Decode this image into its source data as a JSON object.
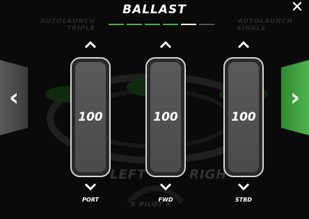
{
  "header": {
    "title": "BALLAST",
    "close_glyph": "✕"
  },
  "background": {
    "autolaunch_left_line1": "AUTOLAUNCH",
    "autolaunch_left_line2": "TRIPLE",
    "autolaunch_right_line1": "AUTOLAUNCH",
    "autolaunch_right_line2": "SINGLE",
    "left_word": "LEFT",
    "right_word": "RIGH",
    "bottom_word": "X PILOT X"
  },
  "pagination": {
    "states": [
      "done",
      "done",
      "done",
      "done",
      "current",
      "inactive"
    ]
  },
  "navigation": {
    "prev_glyph": "‹",
    "next_glyph": "›"
  },
  "tanks": [
    {
      "name": "PORT",
      "value": "100"
    },
    {
      "name": "FWD",
      "value": "100"
    },
    {
      "name": "STBD",
      "value": "100"
    }
  ],
  "colors": {
    "accent_green": "#4caf50",
    "next_panel": "#4fb44f",
    "prev_panel": "#5a5a5a"
  },
  "icons": {
    "increase": "chevron-up-icon",
    "decrease": "chevron-down-icon",
    "close": "close-icon",
    "prev": "chevron-left-icon",
    "next": "chevron-right-icon"
  }
}
